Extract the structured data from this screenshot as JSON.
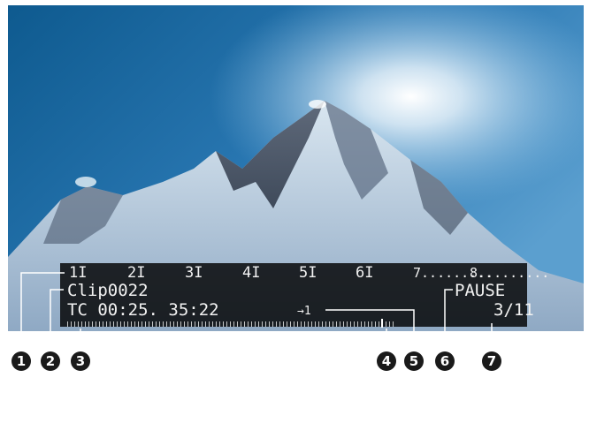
{
  "viewfinder": {
    "marks": [
      "1I",
      "2I",
      "3I",
      "4I",
      "5I",
      "6I",
      "7.........",
      "8........."
    ],
    "clip_name": "Clip0022",
    "timecode": "TC 00:25. 35:22",
    "speed": "→1",
    "status": "PAUSE",
    "clip_count": "3/11",
    "position_fraction": 0.98
  },
  "callouts": [
    "1",
    "2",
    "3",
    "4",
    "5",
    "6",
    "7"
  ],
  "colors": {
    "sky": "#1c5f98",
    "overlay": "#000000",
    "lcd_text": "#f2f2f2",
    "callout": "#1a1a1a"
  }
}
